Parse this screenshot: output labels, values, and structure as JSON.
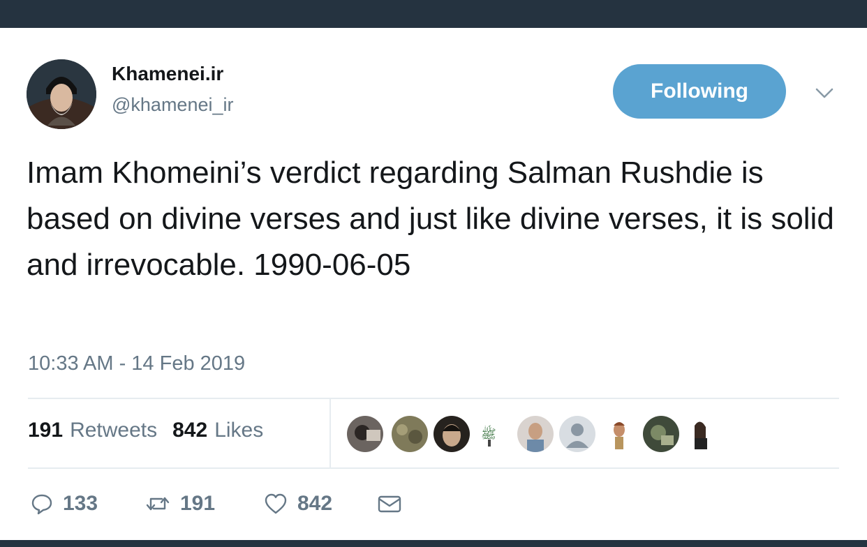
{
  "user": {
    "display_name": "Khamenei.ir",
    "handle": "@khamenei_ir"
  },
  "follow_button": {
    "label": "Following"
  },
  "tweet": {
    "text": "Imam Khomeini’s verdict regarding Salman Rushdie is based on divine verses and just like divine verses, it is solid and irrevocable. 1990-06-05",
    "timestamp": "10:33 AM - 14 Feb 2019"
  },
  "stats": {
    "retweets_count": "191",
    "retweets_label": "Retweets",
    "likes_count": "842",
    "likes_label": "Likes"
  },
  "actions": {
    "reply_count": "133",
    "retweet_count": "191",
    "like_count": "842"
  },
  "icons": {
    "reply": "reply-icon",
    "retweet": "retweet-icon",
    "like": "heart-icon",
    "message": "envelope-icon",
    "menu": "chevron-down-icon"
  },
  "colors": {
    "accent": "#5aa3d1",
    "header_bar": "#253340",
    "muted_text": "#657786"
  }
}
